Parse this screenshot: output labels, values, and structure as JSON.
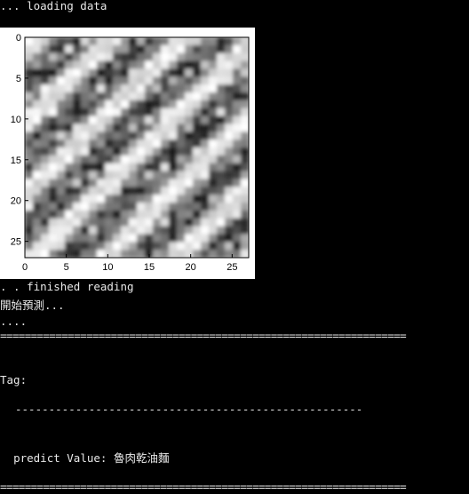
{
  "console": {
    "line_loading": "... loading data",
    "line_finished": ". . finished reading",
    "line_start_predict": "開始預測...",
    "line_dots": "....",
    "separator_top": "==================================================================",
    "tag_label": "Tag:",
    "dash_line": "----------------------------------------------------",
    "predict_label": "predict Value: ",
    "predict_value": "魯肉乾油麵",
    "separator_bottom": "=================================================================="
  },
  "chart_data": {
    "type": "heatmap",
    "title": "",
    "xlabel": "",
    "ylabel": "",
    "colormap": "gray",
    "image_size": [
      28,
      28
    ],
    "xlim": [
      0,
      27
    ],
    "ylim": [
      27,
      0
    ],
    "xticks": [
      "0",
      "5",
      "10",
      "15",
      "20",
      "25"
    ],
    "yticks": [
      "0",
      "5",
      "10",
      "15",
      "20",
      "25"
    ],
    "x_tick_values": [
      0,
      5,
      10,
      15,
      20,
      25
    ],
    "y_tick_values": [
      0,
      5,
      10,
      15,
      20,
      25
    ]
  }
}
